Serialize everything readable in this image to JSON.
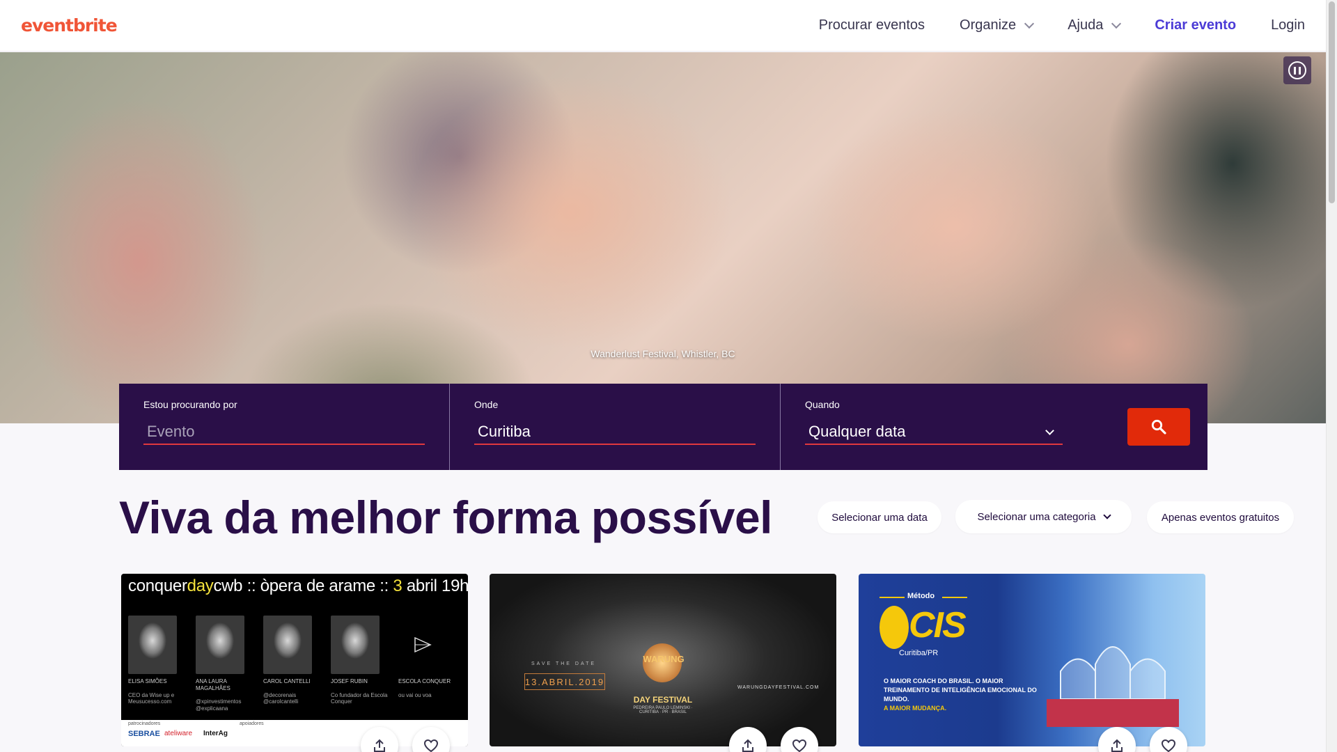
{
  "header": {
    "logo": "eventbrite",
    "nav": {
      "browse": "Procurar eventos",
      "organize": "Organize",
      "help": "Ajuda",
      "create": "Criar evento",
      "login": "Login"
    }
  },
  "hero": {
    "caption": "Wanderlust Festival, Whistler, BC",
    "pause_icon": "pause-icon"
  },
  "search": {
    "what_label": "Estou procurando por",
    "what_placeholder": "Evento",
    "where_label": "Onde",
    "where_value": "Curitiba",
    "when_label": "Quando",
    "when_value": "Qualquer data",
    "button_icon": "search-icon"
  },
  "section": {
    "title": "Viva da melhor forma possível",
    "filters": {
      "date": "Selecionar uma data",
      "category": "Selecionar uma categoria",
      "free": "Apenas eventos gratuitos"
    }
  },
  "cards": [
    {
      "title_pre": "conquer",
      "title_hl": "day",
      "title_mid": "cwb :: òpera de arame :: ",
      "title_num": "3",
      "title_post": " abril 19h",
      "people": [
        {
          "name": "ELISA SIMÕES",
          "desc": "CEO da Wise up e Meusucesso.com"
        },
        {
          "name": "ANA LAURA MAGALHÃES",
          "desc": "@xpinvestimentos @explicaana"
        },
        {
          "name": "CAROL CANTELLI",
          "desc": "@decorenais @carolcantelli"
        },
        {
          "name": "JOSEF RUBIN",
          "desc": "Co fundador da Escola Conquer"
        },
        {
          "name": "ESCOLA CONQUER",
          "desc": "ou vai ou voa"
        }
      ],
      "sponsor_label": "patrocinadores",
      "support_label": "apoiadores",
      "sponsors": [
        "SEBRAE",
        "ateliware",
        "InterAg"
      ]
    },
    {
      "save_top": "SAVE THE DATE",
      "date": "13.ABRIL.2019",
      "logo": "WARUNG",
      "festival": "DAY FESTIVAL",
      "venue": "PEDREIRA PAULO LEMINSKI · CURITIBA · PR · BRASIL",
      "url": "WARUNGDAYFESTIVAL.COM"
    },
    {
      "method": "Método",
      "brand": "CIS",
      "city": "Curitiba/PR",
      "line1": "O MAIOR COACH DO BRASIL. O MAIOR TREINAMENTO DE INTELIGÊNCIA EMOCIONAL DO MUNDO.",
      "line2": "A MAIOR MUDANÇA."
    }
  ],
  "card_actions": {
    "share_icon": "share-icon",
    "like_icon": "heart-icon"
  }
}
